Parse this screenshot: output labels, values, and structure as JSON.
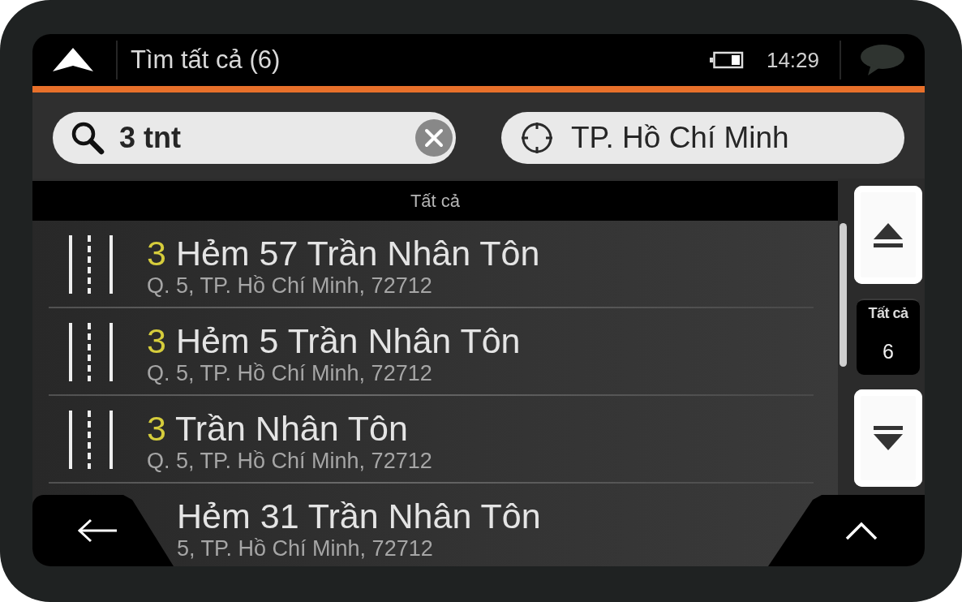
{
  "header": {
    "title": "Tìm tất cả (6)",
    "time": "14:29"
  },
  "search": {
    "value": "3 tnt"
  },
  "location": {
    "value": "TP. Hồ Chí Minh"
  },
  "results": {
    "heading": "Tất cả",
    "items": [
      {
        "kind": "result",
        "match": "3",
        "name": "Hẻm 57 Trần Nhân Tôn",
        "address": "Q. 5, TP. Hồ Chí Minh, 72712"
      },
      {
        "kind": "result",
        "match": "3",
        "name": "Hẻm 5 Trần Nhân Tôn",
        "address": "Q. 5, TP. Hồ Chí Minh, 72712"
      },
      {
        "kind": "result",
        "match": "3",
        "name": "Trần Nhân Tôn",
        "address": "Q. 5, TP. Hồ Chí Minh, 72712"
      },
      {
        "kind": "partial",
        "name": "Hẻm 31 Trần Nhân Tôn",
        "address": "5, TP. Hồ Chí Minh, 72712"
      }
    ]
  },
  "pager": {
    "label": "Tất cả",
    "count": "6"
  }
}
